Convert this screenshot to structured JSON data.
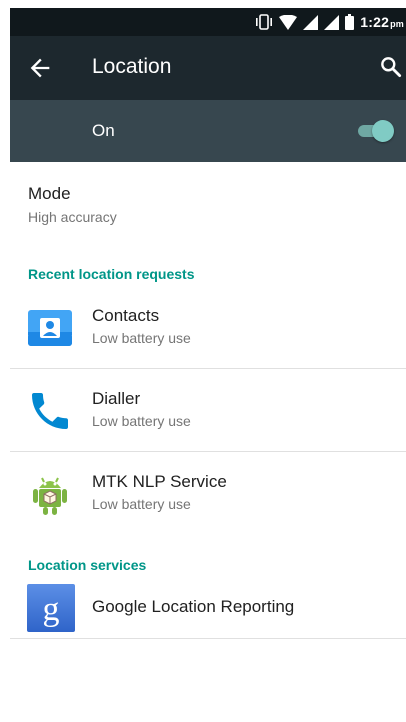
{
  "status_bar": {
    "time": "1:22",
    "ampm": "pm",
    "icons": [
      "vibrate-icon",
      "wifi-icon",
      "signal-1-icon",
      "signal-2-icon",
      "battery-icon"
    ]
  },
  "app_bar": {
    "title": "Location",
    "back_icon": "arrow-back-icon",
    "search_icon": "search-icon"
  },
  "master_switch": {
    "label": "On",
    "state": "on",
    "accent": "#80cbc4"
  },
  "mode": {
    "title": "Mode",
    "summary": "High accuracy"
  },
  "recent_requests": {
    "header": "Recent location requests",
    "items": [
      {
        "name": "Contacts",
        "summary": "Low battery use",
        "icon": "contacts-icon"
      },
      {
        "name": "Dialler",
        "summary": "Low battery use",
        "icon": "phone-icon"
      },
      {
        "name": "MTK NLP Service",
        "summary": "Low battery use",
        "icon": "android-icon"
      }
    ]
  },
  "location_services": {
    "header": "Location services",
    "items": [
      {
        "name": "Google Location Reporting",
        "icon": "google-settings-icon"
      }
    ]
  },
  "colors": {
    "status_bar": "#10181c",
    "app_bar": "#1d282e",
    "switch_bar": "#37474f",
    "accent": "#009688"
  }
}
